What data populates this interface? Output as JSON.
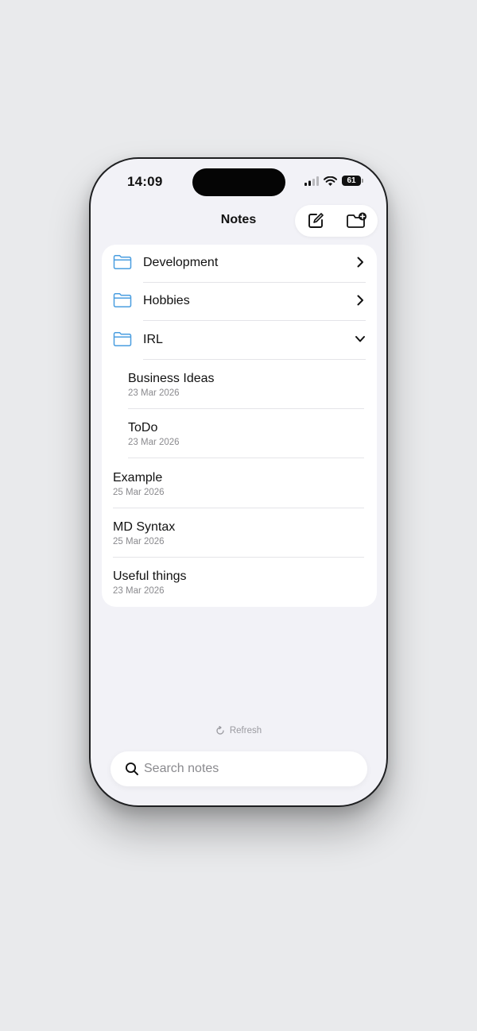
{
  "status_bar": {
    "time": "14:09",
    "battery": "61"
  },
  "nav": {
    "title": "Notes",
    "compose_icon": "compose-icon",
    "new_folder_icon": "folder-plus-icon"
  },
  "folders": [
    {
      "label": "Development",
      "state": "collapsed"
    },
    {
      "label": "Hobbies",
      "state": "collapsed"
    },
    {
      "label": "IRL",
      "state": "expanded"
    }
  ],
  "folder_notes": [
    {
      "title": "Business Ideas",
      "date": "23 Mar 2026"
    },
    {
      "title": "ToDo",
      "date": "23 Mar 2026"
    }
  ],
  "notes": [
    {
      "title": "Example",
      "date": "25 Mar 2026"
    },
    {
      "title": "MD Syntax",
      "date": "25 Mar 2026"
    },
    {
      "title": "Useful things",
      "date": "23 Mar 2026"
    }
  ],
  "refresh_label": "Refresh",
  "search": {
    "placeholder": "Search notes",
    "value": ""
  },
  "colors": {
    "accent": "#4a9ee0",
    "background": "#f2f2f7",
    "card": "#ffffff"
  }
}
